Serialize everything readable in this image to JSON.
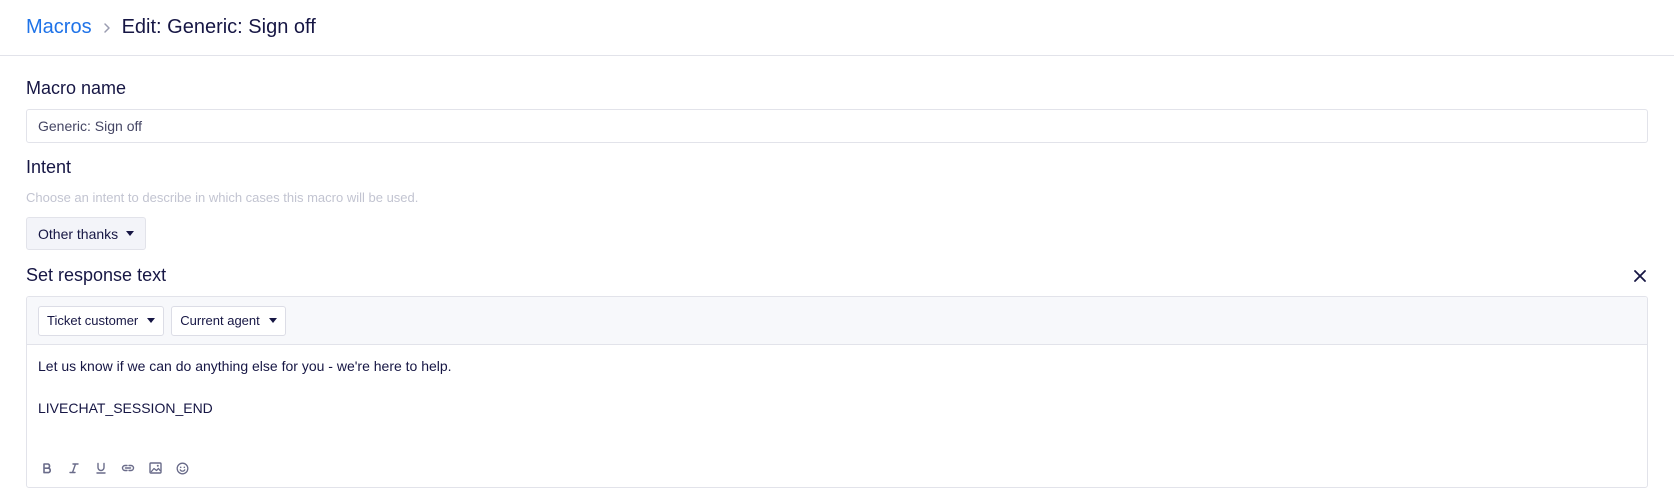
{
  "breadcrumb": {
    "parent": "Macros",
    "current": "Edit: Generic: Sign off"
  },
  "macro_name": {
    "label": "Macro name",
    "value": "Generic: Sign off"
  },
  "intent": {
    "label": "Intent",
    "help": "Choose an intent to describe in which cases this macro will be used.",
    "selected": "Other thanks"
  },
  "response": {
    "label": "Set response text",
    "variables": [
      "Ticket customer",
      "Current agent"
    ],
    "lines": [
      "Let us know if we can do anything else for you - we're here to help.",
      "",
      "LIVECHAT_SESSION_END"
    ],
    "format_tools": [
      "bold-icon",
      "italic-icon",
      "underline-icon",
      "link-icon",
      "image-icon",
      "emoji-icon"
    ]
  },
  "colors": {
    "accent": "#1f73e8",
    "text": "#161644",
    "border": "#e2e3ea",
    "icon": "#6a6c8a"
  }
}
